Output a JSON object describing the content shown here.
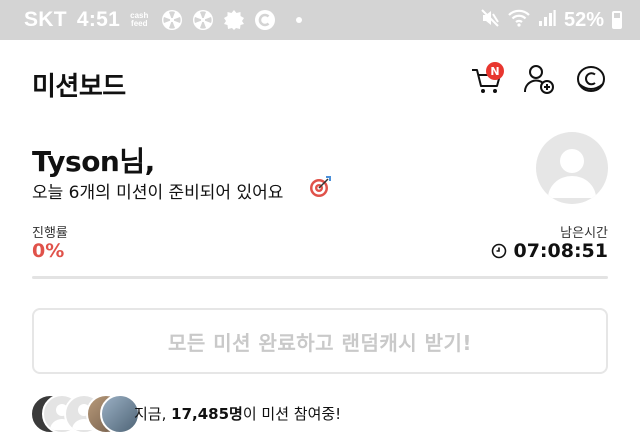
{
  "status_bar": {
    "carrier": "SKT",
    "time": "4:51",
    "cashfeed_line1": "cash",
    "cashfeed_line2": "feed",
    "battery": "52%",
    "icons": [
      "fan-icon",
      "fan-icon",
      "gear-badge-icon",
      "c-coin-icon",
      "mute-icon",
      "wifi-icon",
      "signal-icon",
      "battery-icon"
    ]
  },
  "header": {
    "title": "미션보드",
    "cart_badge": "N",
    "icons": [
      "cart-icon",
      "add-user-icon",
      "cash-coin-icon"
    ]
  },
  "greeting": {
    "name": "Tyson님,",
    "subtitle": "오늘 6개의 미션이 준비되어 있어요",
    "subtitle_icon": "target-icon"
  },
  "progress": {
    "label": "진행률",
    "value": "0%",
    "remaining_label": "남은시간",
    "remaining_value": "07:08:51"
  },
  "claim_button": {
    "label": "모든 미션 완료하고 랜덤캐시 받기!"
  },
  "participants": {
    "prefix": "지금, ",
    "count": "17,485명",
    "suffix": "이 미션 참여중!"
  },
  "colors": {
    "status_bar_bg": "#d4d4d4",
    "progress_value": "#e0524a",
    "badge": "#e8362f",
    "button_text": "#c9c9c9"
  }
}
